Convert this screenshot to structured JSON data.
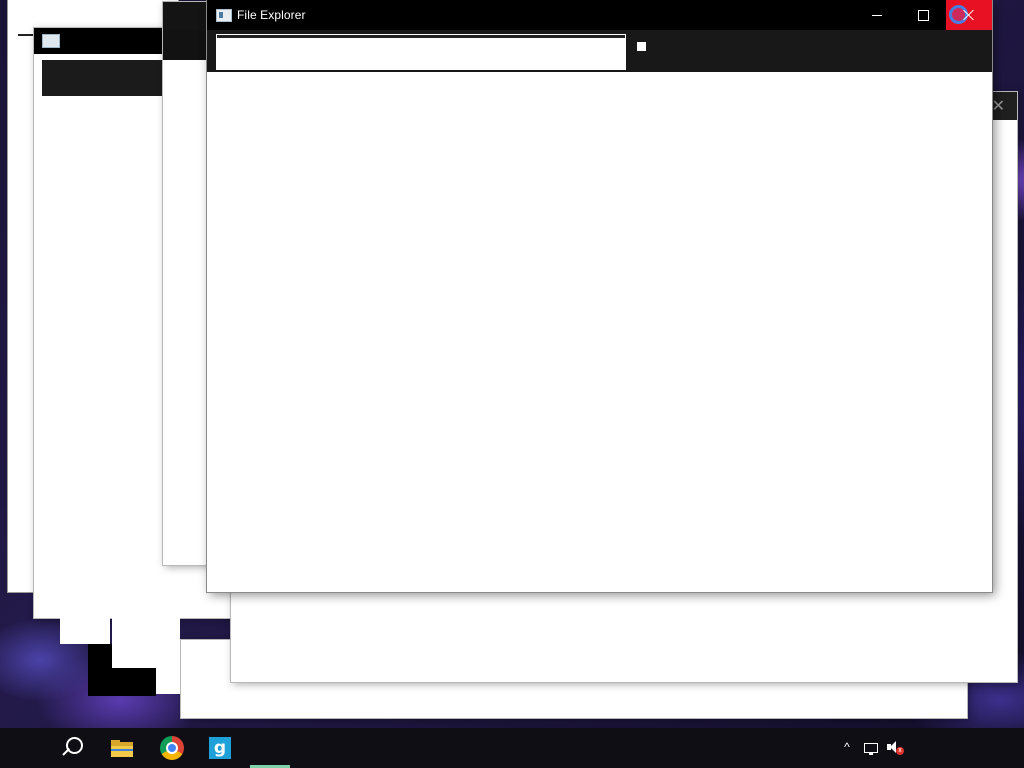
{
  "window": {
    "title": "File Explorer",
    "buttons": {
      "minimize": "minimize",
      "maximize": "maximize",
      "close": "close"
    }
  },
  "taskbar": {
    "apps": [
      {
        "icon": "search-icon"
      },
      {
        "icon": "folder-icon"
      },
      {
        "icon": "chrome-icon"
      },
      {
        "icon": "g-app-icon",
        "label": "g"
      }
    ],
    "tray": {
      "chevron": "^",
      "mute_badge": "x"
    }
  },
  "colors": {
    "titlebar": "#000000",
    "close_hover": "#e81123",
    "toolbar": "#181818",
    "taskbar": "#0f0e14",
    "g_app": "#1da1d8"
  }
}
